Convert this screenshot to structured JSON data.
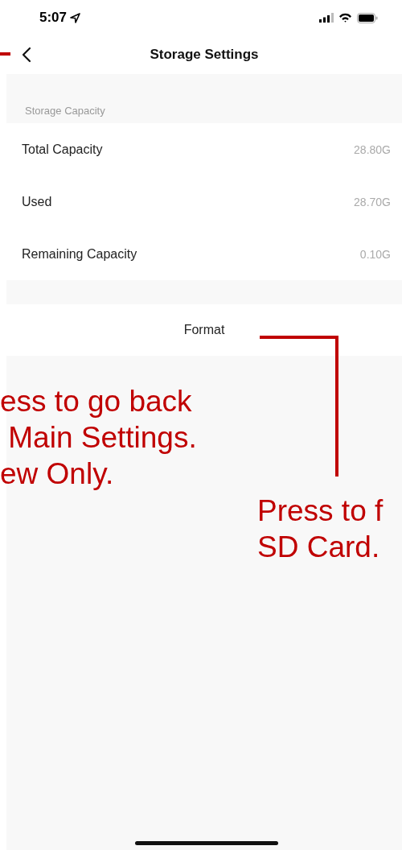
{
  "status_bar": {
    "time": "5:07"
  },
  "nav": {
    "title": "Storage Settings"
  },
  "section": {
    "header": "Storage Capacity",
    "rows": [
      {
        "label": "Total Capacity",
        "value": "28.80G"
      },
      {
        "label": "Used",
        "value": "28.70G"
      },
      {
        "label": "Remaining Capacity",
        "value": "0.10G"
      }
    ]
  },
  "format_button": {
    "label": "Format"
  },
  "annotations": [
    {
      "kind": "left",
      "lines": [
        "ess to go back",
        " Main Settings.",
        "ew Only."
      ]
    },
    {
      "kind": "right",
      "lines": [
        "Press to f",
        "SD Card."
      ]
    }
  ]
}
